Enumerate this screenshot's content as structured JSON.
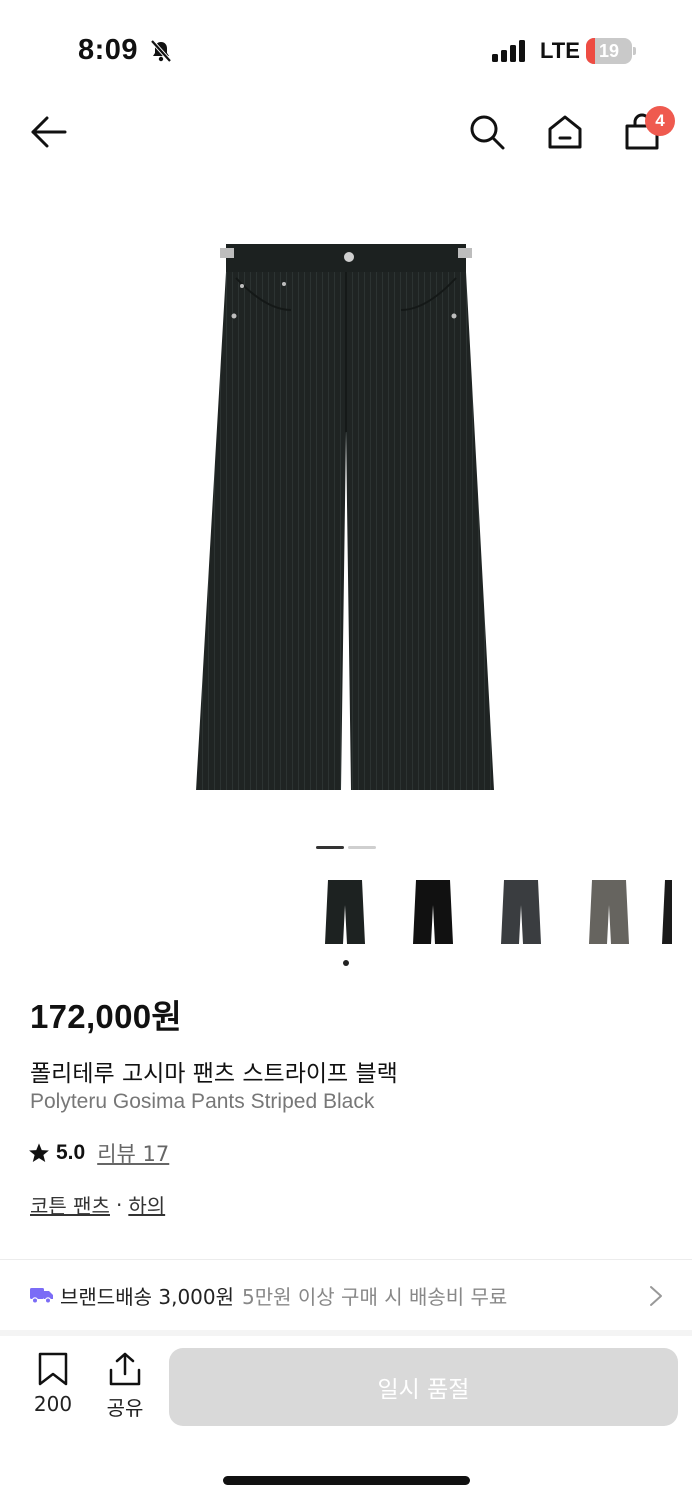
{
  "status_bar": {
    "time": "8:09",
    "network": "LTE",
    "battery_level": "19",
    "battery_fraction": 0.19
  },
  "nav": {
    "cart_count": "4"
  },
  "gallery": {
    "current_page": 1,
    "total_pages": 2,
    "color_options": 5,
    "selected_color_index": 0
  },
  "product": {
    "price": "172,000원",
    "name_kr": "폴리테루 고시마 팬츠 스트라이프 블랙",
    "name_en": "Polyteru Gosima Pants Striped Black",
    "rating": "5.0",
    "review_label": "리뷰 17",
    "category_1": "코튼 팬츠",
    "category_separator": "·",
    "category_2": "하의"
  },
  "shipping": {
    "label": "브랜드배송 3,000원",
    "note": "5만원 이상 구매 시 배송비 무료"
  },
  "bottom_bar": {
    "bookmark_count": "200",
    "share_label": "공유",
    "cta_label": "일시 품절"
  },
  "colors": {
    "badge": "#ef5a4f",
    "truck": "#7b6cf6",
    "cta_disabled_bg": "#d9d9d9"
  }
}
